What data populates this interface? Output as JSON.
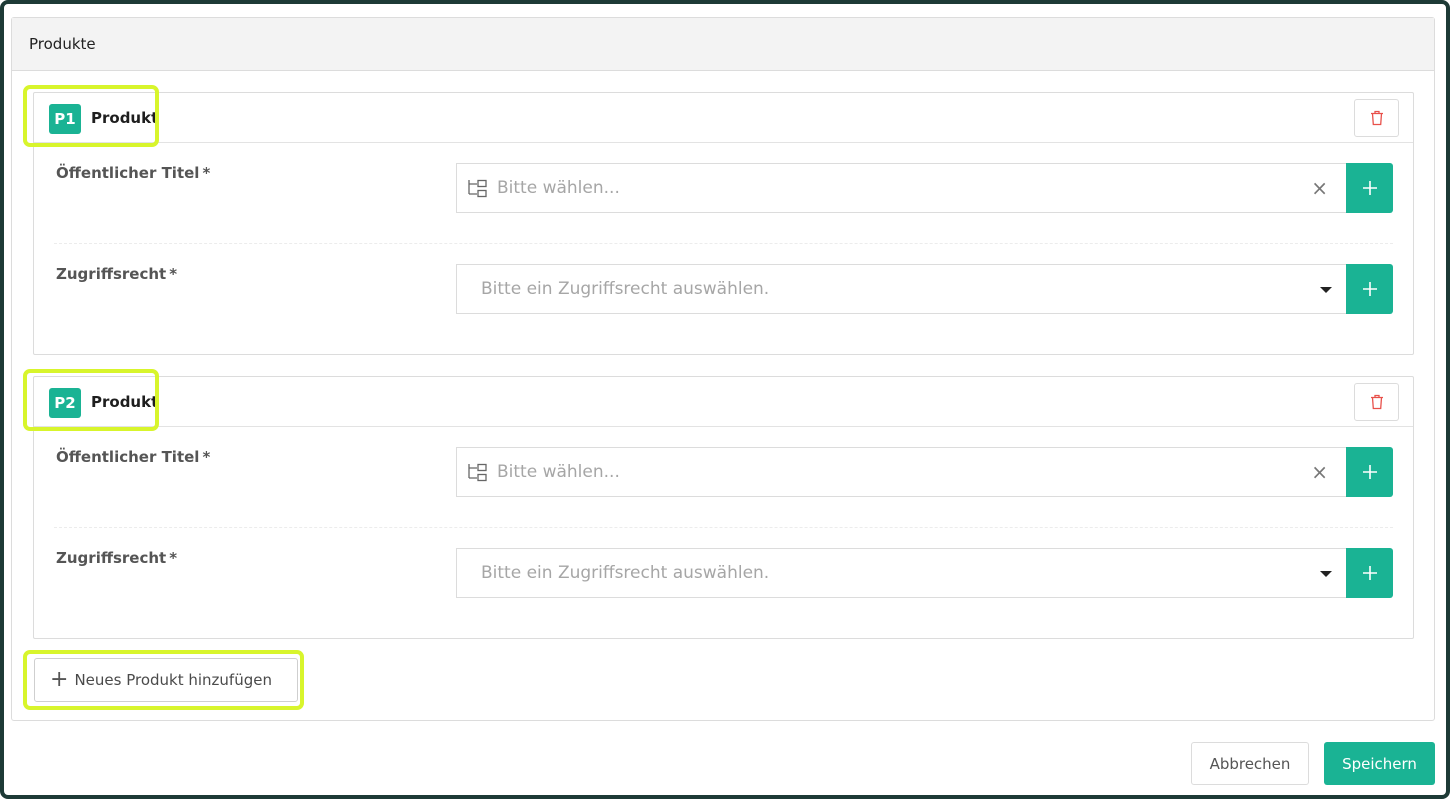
{
  "panel": {
    "title": "Produkte"
  },
  "products": [
    {
      "badge": "P1",
      "title": "Produkt",
      "fields": {
        "public_title": {
          "label": "Öffentlicher Titel",
          "required_mark": "*",
          "placeholder": "Bitte wählen...",
          "clear_glyph": "×"
        },
        "access_right": {
          "label": "Zugriffsrecht",
          "required_mark": "*",
          "placeholder": "Bitte ein Zugriffsrecht auswählen."
        }
      }
    },
    {
      "badge": "P2",
      "title": "Produkt",
      "fields": {
        "public_title": {
          "label": "Öffentlicher Titel",
          "required_mark": "*",
          "placeholder": "Bitte wählen...",
          "clear_glyph": "×"
        },
        "access_right": {
          "label": "Zugriffsrecht",
          "required_mark": "*",
          "placeholder": "Bitte ein Zugriffsrecht auswählen."
        }
      }
    }
  ],
  "add_product": {
    "plus": "+",
    "label": "Neues Produkt hinzufügen"
  },
  "footer": {
    "cancel_label": "Abbrechen",
    "save_label": "Speichern"
  },
  "colors": {
    "accent": "#1ab394",
    "highlight": "#d8f52c",
    "frame": "#1d3a36",
    "delete_icon": "#e8504a"
  },
  "icons": {
    "delete": "trash-icon",
    "tree": "tree-structure-icon",
    "add": "plus-icon",
    "dropdown": "caret-down-icon",
    "clear": "close-icon"
  }
}
